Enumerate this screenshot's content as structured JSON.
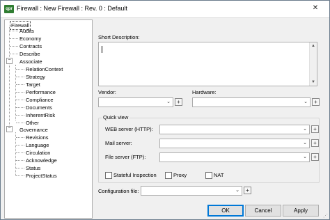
{
  "window": {
    "title": "Firewall : New Firewall : Rev. 0 : Default",
    "app_icon_text": "qpr",
    "close_glyph": "✕"
  },
  "tree": {
    "items": [
      {
        "label": "Firewall",
        "level": 0
      },
      {
        "label": "Audits",
        "level": 1
      },
      {
        "label": "Economy",
        "level": 1
      },
      {
        "label": "Contracts",
        "level": 1
      },
      {
        "label": "Describe",
        "level": 1
      },
      {
        "label": "Associate",
        "level": 1
      },
      {
        "label": "RelationContext",
        "level": 2
      },
      {
        "label": "Strategy",
        "level": 2
      },
      {
        "label": "Target",
        "level": 2
      },
      {
        "label": "Performance",
        "level": 2
      },
      {
        "label": "Compliance",
        "level": 2
      },
      {
        "label": "Documents",
        "level": 2
      },
      {
        "label": "InherentRisk",
        "level": 2
      },
      {
        "label": "Other",
        "level": 2
      },
      {
        "label": "Governance",
        "level": 1
      },
      {
        "label": "Revisions",
        "level": 2
      },
      {
        "label": "Language",
        "level": 2
      },
      {
        "label": "Circulation",
        "level": 2
      },
      {
        "label": "Acknowledge",
        "level": 2
      },
      {
        "label": "Status",
        "level": 2
      },
      {
        "label": "ProjectStatus",
        "level": 2
      }
    ],
    "expander_glyph": "−"
  },
  "form": {
    "short_description_label": "Short Description:",
    "short_description_value": "",
    "vendor_label": "Vendor:",
    "vendor_value": "",
    "hardware_label": "Hardware:",
    "hardware_value": "",
    "quick_view_label": "Quick view",
    "web_server_label": "WEB server (HTTP):",
    "web_server_value": "",
    "mail_server_label": "Mail server:",
    "mail_server_value": "",
    "file_server_label": "File server (FTP):",
    "file_server_value": "",
    "stateful_label": "Stateful Inspection",
    "proxy_label": "Proxy",
    "nat_label": "NAT",
    "config_file_label": "Configuration file:",
    "config_file_value": "",
    "plus_glyph": "+",
    "drop_glyph": "⌄"
  },
  "buttons": {
    "ok": "OK",
    "cancel": "Cancel",
    "apply": "Apply"
  }
}
